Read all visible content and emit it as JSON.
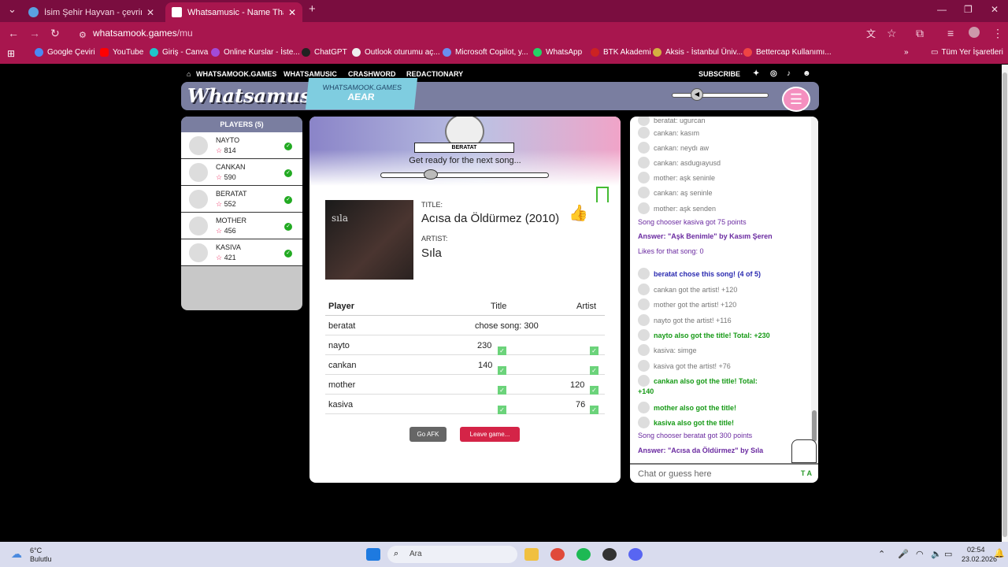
{
  "browser": {
    "tabs": [
      {
        "title": "İsim Şehir Hayvan - çevrimiçi oy"
      },
      {
        "title": "Whatsamusic - Name That Tune"
      }
    ],
    "url_host": "whatsamook.games",
    "url_path": "/mu",
    "bookmarks": [
      "Google Çeviri",
      "YouTube",
      "Giriş - Canva",
      "Online Kurslar - İste...",
      "ChatGPT",
      "Outlook oturumu aç...",
      "Microsoft Copilot, y...",
      "WhatsApp",
      "BTK Akademi",
      "Aksis - İstanbul Üniv...",
      "Bettercap Kullanımı..."
    ],
    "all_bookmarks": "Tüm Yer İşaretleri"
  },
  "site": {
    "nav": [
      "WHATSAMOOK.GAMES",
      "WHATSAMUSIC",
      "CRASHWORD",
      "REDACTIONARY"
    ],
    "subscribe": "SUBSCRIBE",
    "logo": "Whatsamusic",
    "badge_top": "WHATSAMOOK.GAMES",
    "badge_bottom": "AEAR"
  },
  "players": {
    "header": "PLAYERS (5)",
    "list": [
      {
        "name": "NAYTO",
        "score": "814"
      },
      {
        "name": "CANKAN",
        "score": "590"
      },
      {
        "name": "BERATAT",
        "score": "552"
      },
      {
        "name": "MOTHER",
        "score": "456"
      },
      {
        "name": "KASIVA",
        "score": "421"
      }
    ]
  },
  "main": {
    "chooser": "BERATAT",
    "status": "Get ready for the next song...",
    "timer_fraction": 0.3,
    "cover_text": "sıla",
    "title_label": "TITLE:",
    "title": "Acısa da Öldürmez (2010)",
    "artist_label": "ARTIST:",
    "artist": "Sıla",
    "table": {
      "headers": [
        "Player",
        "Title",
        "Artist"
      ],
      "rows": [
        {
          "player": "beratat",
          "title": "",
          "artist": "",
          "note": "chose song: 300"
        },
        {
          "player": "nayto",
          "title": "230",
          "artist": ""
        },
        {
          "player": "cankan",
          "title": "140",
          "artist": ""
        },
        {
          "player": "mother",
          "title": "",
          "artist": "120"
        },
        {
          "player": "kasiva",
          "title": "",
          "artist": "76"
        }
      ]
    },
    "afk_button": "Go AFK",
    "leave_button": "Leave game..."
  },
  "chat": {
    "lines": [
      {
        "text": "beratat: ugurcan",
        "style": "g",
        "avatar": true
      },
      {
        "text": "cankan: kasım",
        "style": "g",
        "avatar": true
      },
      {
        "text": "cankan: neydı aw",
        "style": "g",
        "avatar": true
      },
      {
        "text": "cankan: asdugıayusd",
        "style": "g",
        "avatar": true
      },
      {
        "text": "mother: aşk seninle",
        "style": "g",
        "avatar": true
      },
      {
        "text": "cankan: aş seninle",
        "style": "g",
        "avatar": true
      },
      {
        "text": "mother: aşk senden",
        "style": "g",
        "avatar": true
      },
      {
        "text": "Song chooser kasiva got 75 points",
        "style": "pu",
        "avatar": false
      },
      {
        "text": "Answer: \"Aşk Benimle\" by Kasım Şeren",
        "style": "pu b",
        "avatar": false
      },
      {
        "text": "Likes for that song: 0",
        "style": "pu",
        "avatar": false
      },
      {
        "text": "beratat chose this song! (4 of 5)",
        "style": "bl",
        "avatar": true
      },
      {
        "text": "cankan got the artist! +120",
        "style": "g",
        "avatar": true
      },
      {
        "text": "mother got the artist! +120",
        "style": "g",
        "avatar": true
      },
      {
        "text": "nayto got the artist! +116",
        "style": "g",
        "avatar": true
      },
      {
        "text": "nayto also got the title! Total: +230",
        "style": "gr",
        "avatar": true
      },
      {
        "text": "kasiva: simge",
        "style": "g",
        "avatar": true
      },
      {
        "text": "kasiva got the artist! +76",
        "style": "g",
        "avatar": true
      },
      {
        "text": "cankan also got the title! Total:",
        "style": "gr",
        "avatar": true
      },
      {
        "text": "+140",
        "style": "gr",
        "avatar": false
      },
      {
        "text": "mother also got the title!",
        "style": "gr",
        "avatar": true
      },
      {
        "text": "kasiva also got the title!",
        "style": "gr",
        "avatar": true
      },
      {
        "text": "Song chooser beratat got 300 points",
        "style": "pu",
        "avatar": false
      },
      {
        "text": "Answer: \"Acısa da Öldürmez\" by Sıla",
        "style": "pu b",
        "avatar": false
      }
    ],
    "placeholder": "Chat or guess here",
    "input_hint": "T A"
  },
  "taskbar": {
    "weather_temp": "6°C",
    "weather_desc": "Bulutlu",
    "search": "Ara",
    "time": "02:54",
    "date": "23.02.2026"
  }
}
